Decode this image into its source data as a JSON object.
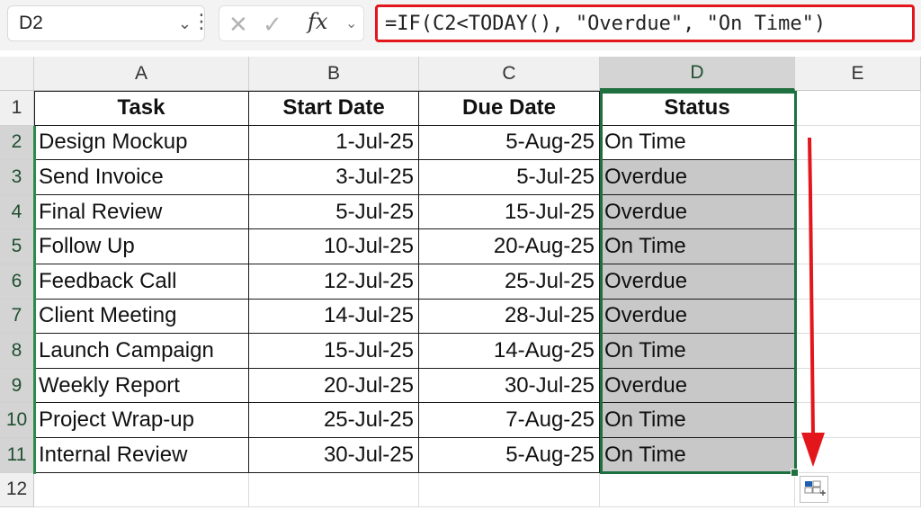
{
  "formula_bar": {
    "name_box": "D2",
    "formula": "=IF(C2<TODAY(), \"Overdue\", \"On Time\")",
    "fx_label": "fx"
  },
  "columns": [
    "A",
    "B",
    "C",
    "D",
    "E"
  ],
  "selected_column": "D",
  "rows": [
    "1",
    "2",
    "3",
    "4",
    "5",
    "6",
    "7",
    "8",
    "9",
    "10",
    "11",
    "12"
  ],
  "table": {
    "headers": [
      "Task",
      "Start Date",
      "Due Date",
      "Status"
    ],
    "rows": [
      [
        "Design Mockup",
        "1-Jul-25",
        "5-Aug-25",
        "On Time"
      ],
      [
        "Send Invoice",
        "3-Jul-25",
        "5-Jul-25",
        "Overdue"
      ],
      [
        "Final Review",
        "5-Jul-25",
        "15-Jul-25",
        "Overdue"
      ],
      [
        "Follow Up",
        "10-Jul-25",
        "20-Aug-25",
        "On Time"
      ],
      [
        "Feedback Call",
        "12-Jul-25",
        "25-Jul-25",
        "Overdue"
      ],
      [
        "Client Meeting",
        "14-Jul-25",
        "28-Jul-25",
        "Overdue"
      ],
      [
        "Launch Campaign",
        "15-Jul-25",
        "14-Aug-25",
        "On Time"
      ],
      [
        "Weekly Report",
        "20-Jul-25",
        "30-Jul-25",
        "Overdue"
      ],
      [
        "Project Wrap-up",
        "25-Jul-25",
        "7-Aug-25",
        "On Time"
      ],
      [
        "Internal Review",
        "30-Jul-25",
        "5-Aug-25",
        "On Time"
      ]
    ]
  },
  "colors": {
    "highlight_border": "#e3161c",
    "selection": "#1f7040",
    "arrow": "#e3161c",
    "fill_shade": "#c8c8c8"
  },
  "icons": {
    "cancel": "close-icon",
    "enter": "check-icon",
    "function": "fx-icon",
    "quick_analysis": "quick-analysis-icon"
  }
}
